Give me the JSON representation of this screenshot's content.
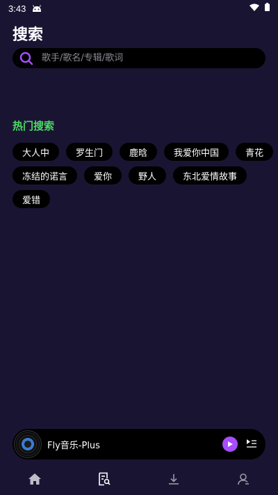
{
  "status_bar": {
    "time": "3:43",
    "icons": [
      "android-icon",
      "wifi-icon",
      "battery-icon"
    ]
  },
  "header": {
    "title": "搜索"
  },
  "search": {
    "placeholder": "歌手/歌名/专辑/歌词",
    "value": "",
    "icon": "search-icon"
  },
  "hot_search": {
    "title": "热门搜索",
    "rows": [
      [
        "大人中",
        "罗生门",
        "鹿晗",
        "我爱你中国",
        "青花"
      ],
      [
        "冻结的诺言",
        "爱你",
        "野人",
        "东北爱情故事"
      ],
      [
        "爱错"
      ]
    ]
  },
  "player": {
    "title": "Fly音乐-Plus",
    "play_icon": "play-icon",
    "playlist_icon": "playlist-icon"
  },
  "bottom_nav": {
    "items": [
      "home-icon",
      "search-list-icon",
      "download-icon",
      "profile-icon"
    ]
  },
  "colors": {
    "background": "#1a1433",
    "accent_green": "#4cd964",
    "accent_purple": "#a64dff",
    "chip_background": "#000000"
  }
}
